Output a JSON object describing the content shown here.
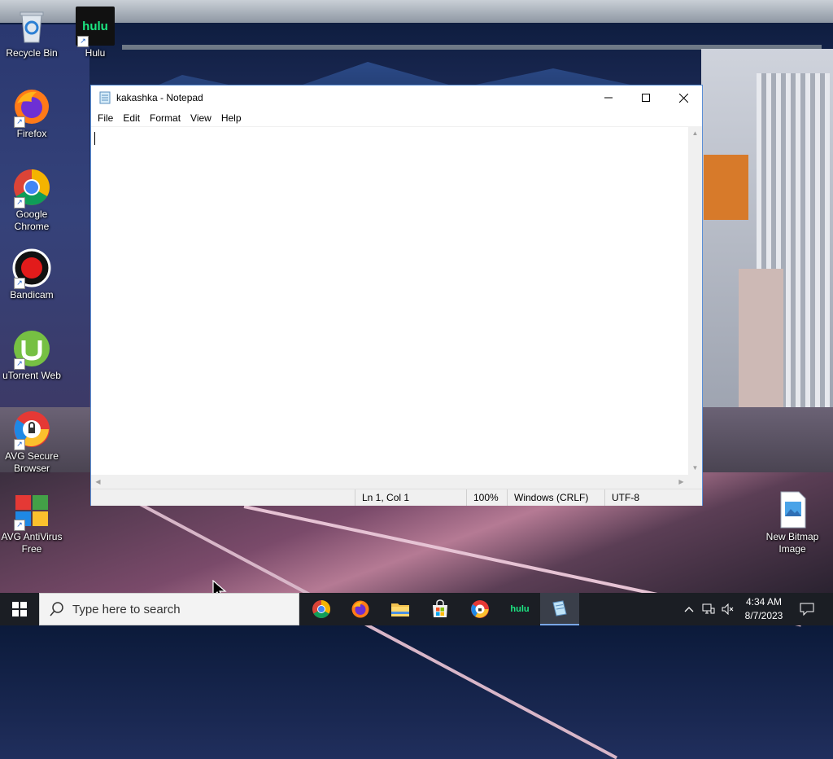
{
  "desktop": {
    "icons": [
      {
        "label": "Recycle Bin",
        "icon": "recycle-bin-icon"
      },
      {
        "label": "Hulu",
        "icon": "hulu-icon"
      },
      {
        "label": "Firefox",
        "icon": "firefox-icon"
      },
      {
        "label": "Google Chrome",
        "icon": "chrome-icon"
      },
      {
        "label": "Bandicam",
        "icon": "bandicam-icon"
      },
      {
        "label": "uTorrent Web",
        "icon": "utorrent-icon"
      },
      {
        "label": "AVG Secure Browser",
        "icon": "avg-secure-browser-icon"
      },
      {
        "label": "AVG AntiVirus Free",
        "icon": "avg-antivirus-icon"
      },
      {
        "label": "New Bitmap Image",
        "icon": "bitmap-file-icon"
      }
    ],
    "hulu_logo_text": "hulu"
  },
  "notepad": {
    "title": "kakashka - Notepad",
    "menu": [
      "File",
      "Edit",
      "Format",
      "View",
      "Help"
    ],
    "content": "",
    "status": {
      "position": "Ln 1, Col 1",
      "zoom": "100%",
      "line_ending": "Windows (CRLF)",
      "encoding": "UTF-8"
    }
  },
  "taskbar": {
    "search_placeholder": "Type here to search",
    "apps": [
      "chrome",
      "firefox",
      "file-explorer",
      "microsoft-store",
      "avg-secure-browser",
      "hulu",
      "notepad"
    ],
    "hulu_text": "hulu",
    "clock_time": "4:34 AM",
    "clock_date": "8/7/2023"
  }
}
